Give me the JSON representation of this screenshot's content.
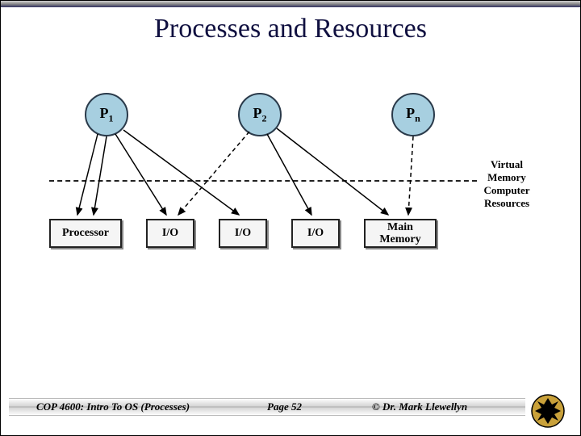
{
  "title": "Processes and Resources",
  "processes": [
    "P",
    "P",
    "P"
  ],
  "process_subs": [
    "1",
    "2",
    "n"
  ],
  "resources": {
    "processor": "Processor",
    "io1": "I/O",
    "io2": "I/O",
    "io3": "I/O",
    "main_memory": "Main\nMemory"
  },
  "labels": {
    "virtual_memory": "Virtual\nMemory",
    "computer_resources": "Computer\nResources"
  },
  "footer": {
    "course": "COP 4600: Intro To OS  (Processes)",
    "page": "Page 52",
    "copyright": "© Dr. Mark Llewellyn"
  }
}
